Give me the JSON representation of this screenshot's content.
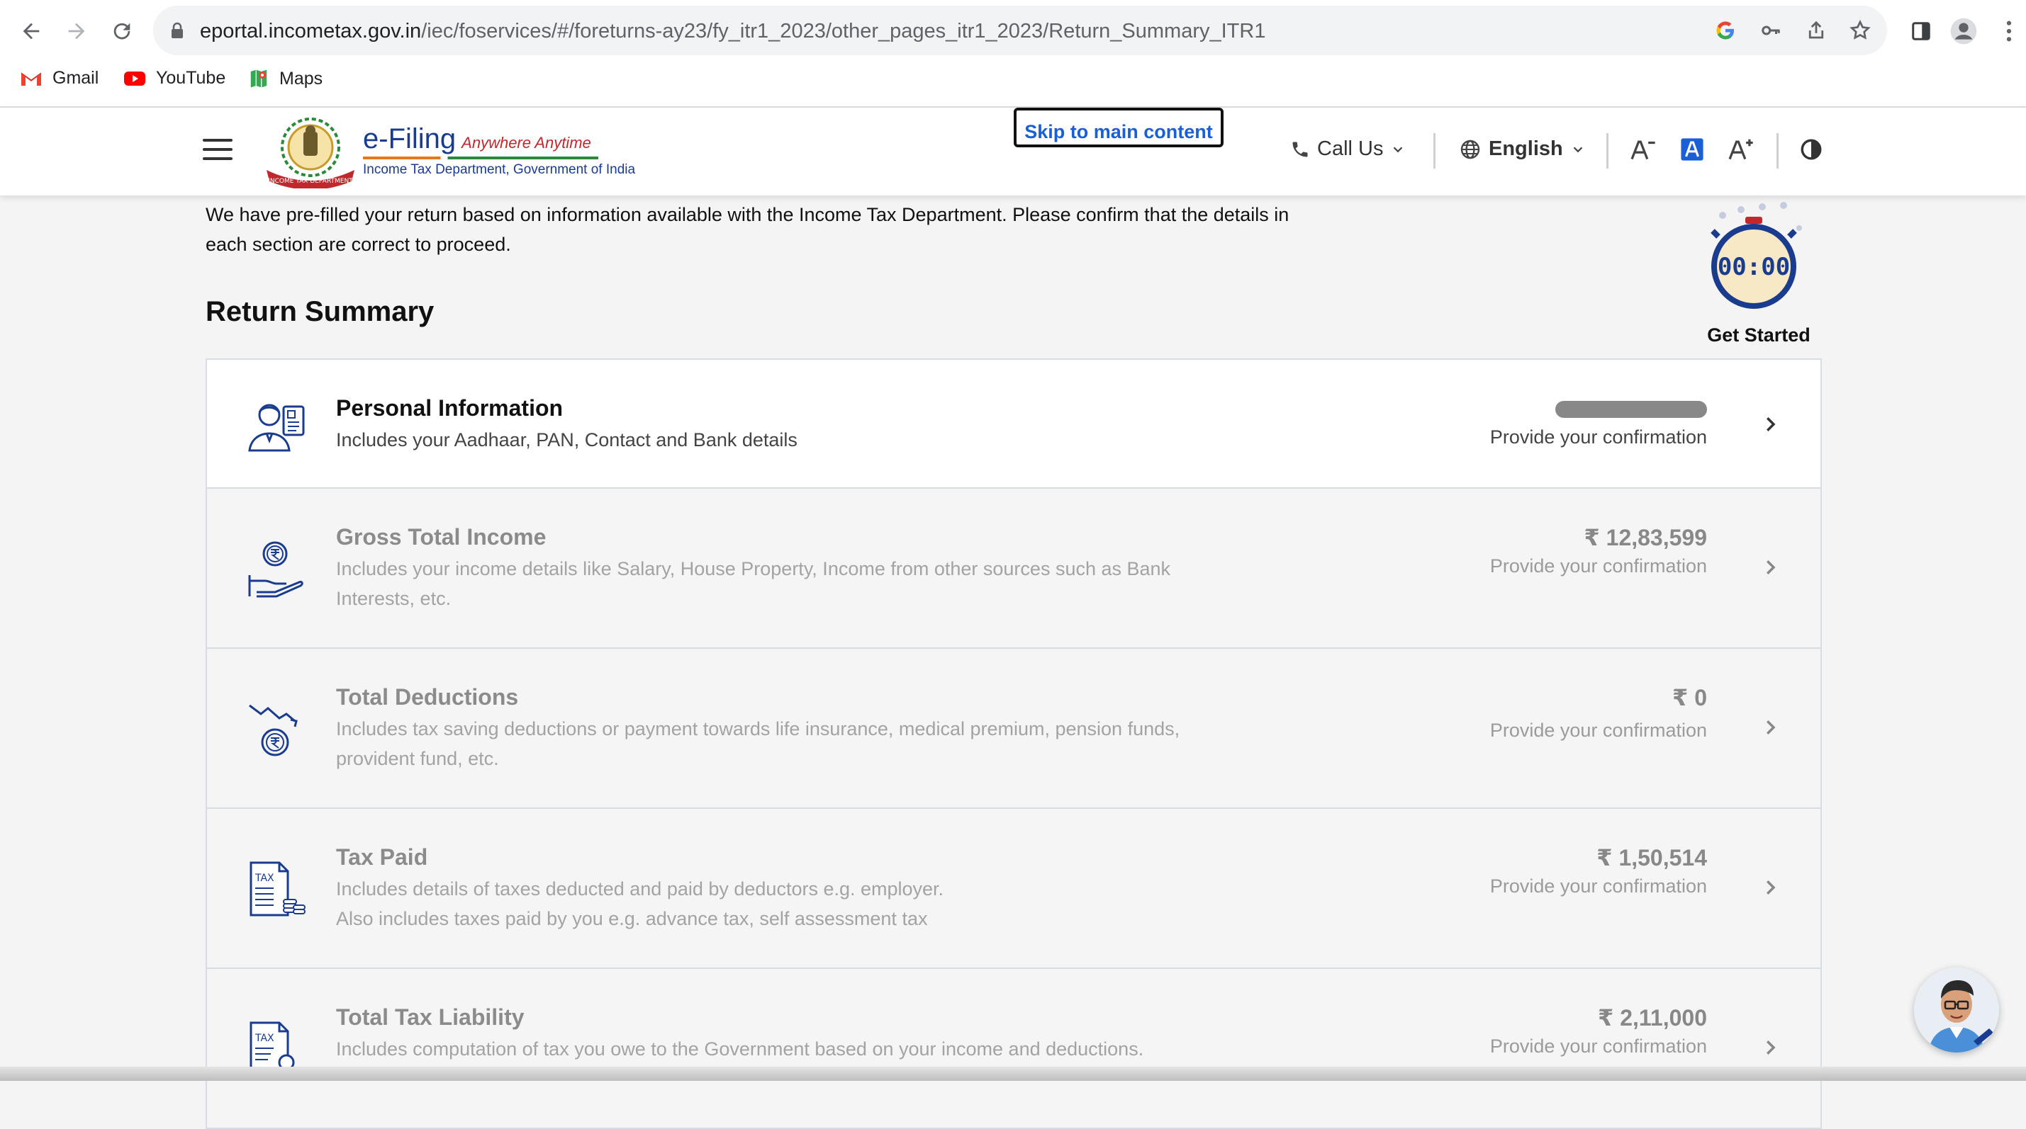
{
  "browser": {
    "url_host": "eportal.incometax.gov.in",
    "url_path": "/iec/foservices/#/foreturns-ay23/fy_itr1_2023/other_pages_itr1_2023/Return_Summary_ITR1",
    "bookmarks": [
      {
        "label": "Gmail",
        "icon": "gmail-icon"
      },
      {
        "label": "YouTube",
        "icon": "youtube-icon"
      },
      {
        "label": "Maps",
        "icon": "maps-icon"
      }
    ]
  },
  "header": {
    "brand_main": "e-Filing",
    "brand_tagline": "Anywhere Anytime",
    "brand_sub": "Income Tax Department, Government of India",
    "emblem_text": "INCOME TAX DEPARTMENT",
    "skip_link": "Skip to main content",
    "call_us": "Call Us",
    "language": "English"
  },
  "page": {
    "intro": "We have pre-filled your return based on information available with the Income Tax Department. Please confirm that the details in each section are correct to proceed.",
    "title": "Return Summary",
    "timer": "00:00",
    "get_started": "Get Started"
  },
  "sections": [
    {
      "title": "Personal Information",
      "desc": "Includes your Aadhaar, PAN, Contact and Bank details",
      "amount": "",
      "status": "Provide your confirmation",
      "icon": "person-id-icon"
    },
    {
      "title": "Gross Total Income",
      "desc": "Includes your income details like Salary, House Property, Income from other sources such as Bank Interests, etc.",
      "amount": "₹ 12,83,599",
      "status": "Provide your confirmation",
      "icon": "rupee-hand-icon"
    },
    {
      "title": "Total Deductions",
      "desc": "Includes tax saving deductions or payment towards life insurance, medical premium, pension funds, provident fund, etc.",
      "amount": "₹ 0",
      "status": "Provide your confirmation",
      "icon": "deduction-trend-icon"
    },
    {
      "title": "Tax Paid",
      "desc1": "Includes details of taxes deducted and paid by deductors e.g. employer.",
      "desc2": "Also includes taxes paid by you e.g. advance tax, self assessment tax",
      "amount": "₹ 1,50,514",
      "status": "Provide your confirmation",
      "icon": "tax-document-icon"
    },
    {
      "title": "Total Tax Liability",
      "desc": "Includes computation of tax you owe to the Government based on your income and deductions.",
      "amount": "₹ 2,11,000",
      "status": "Provide your confirmation",
      "icon": "tax-search-icon"
    }
  ],
  "colors": {
    "brand_blue": "#1a3c8f",
    "link_blue": "#1a5fd6",
    "accent_red": "#c0282d"
  }
}
